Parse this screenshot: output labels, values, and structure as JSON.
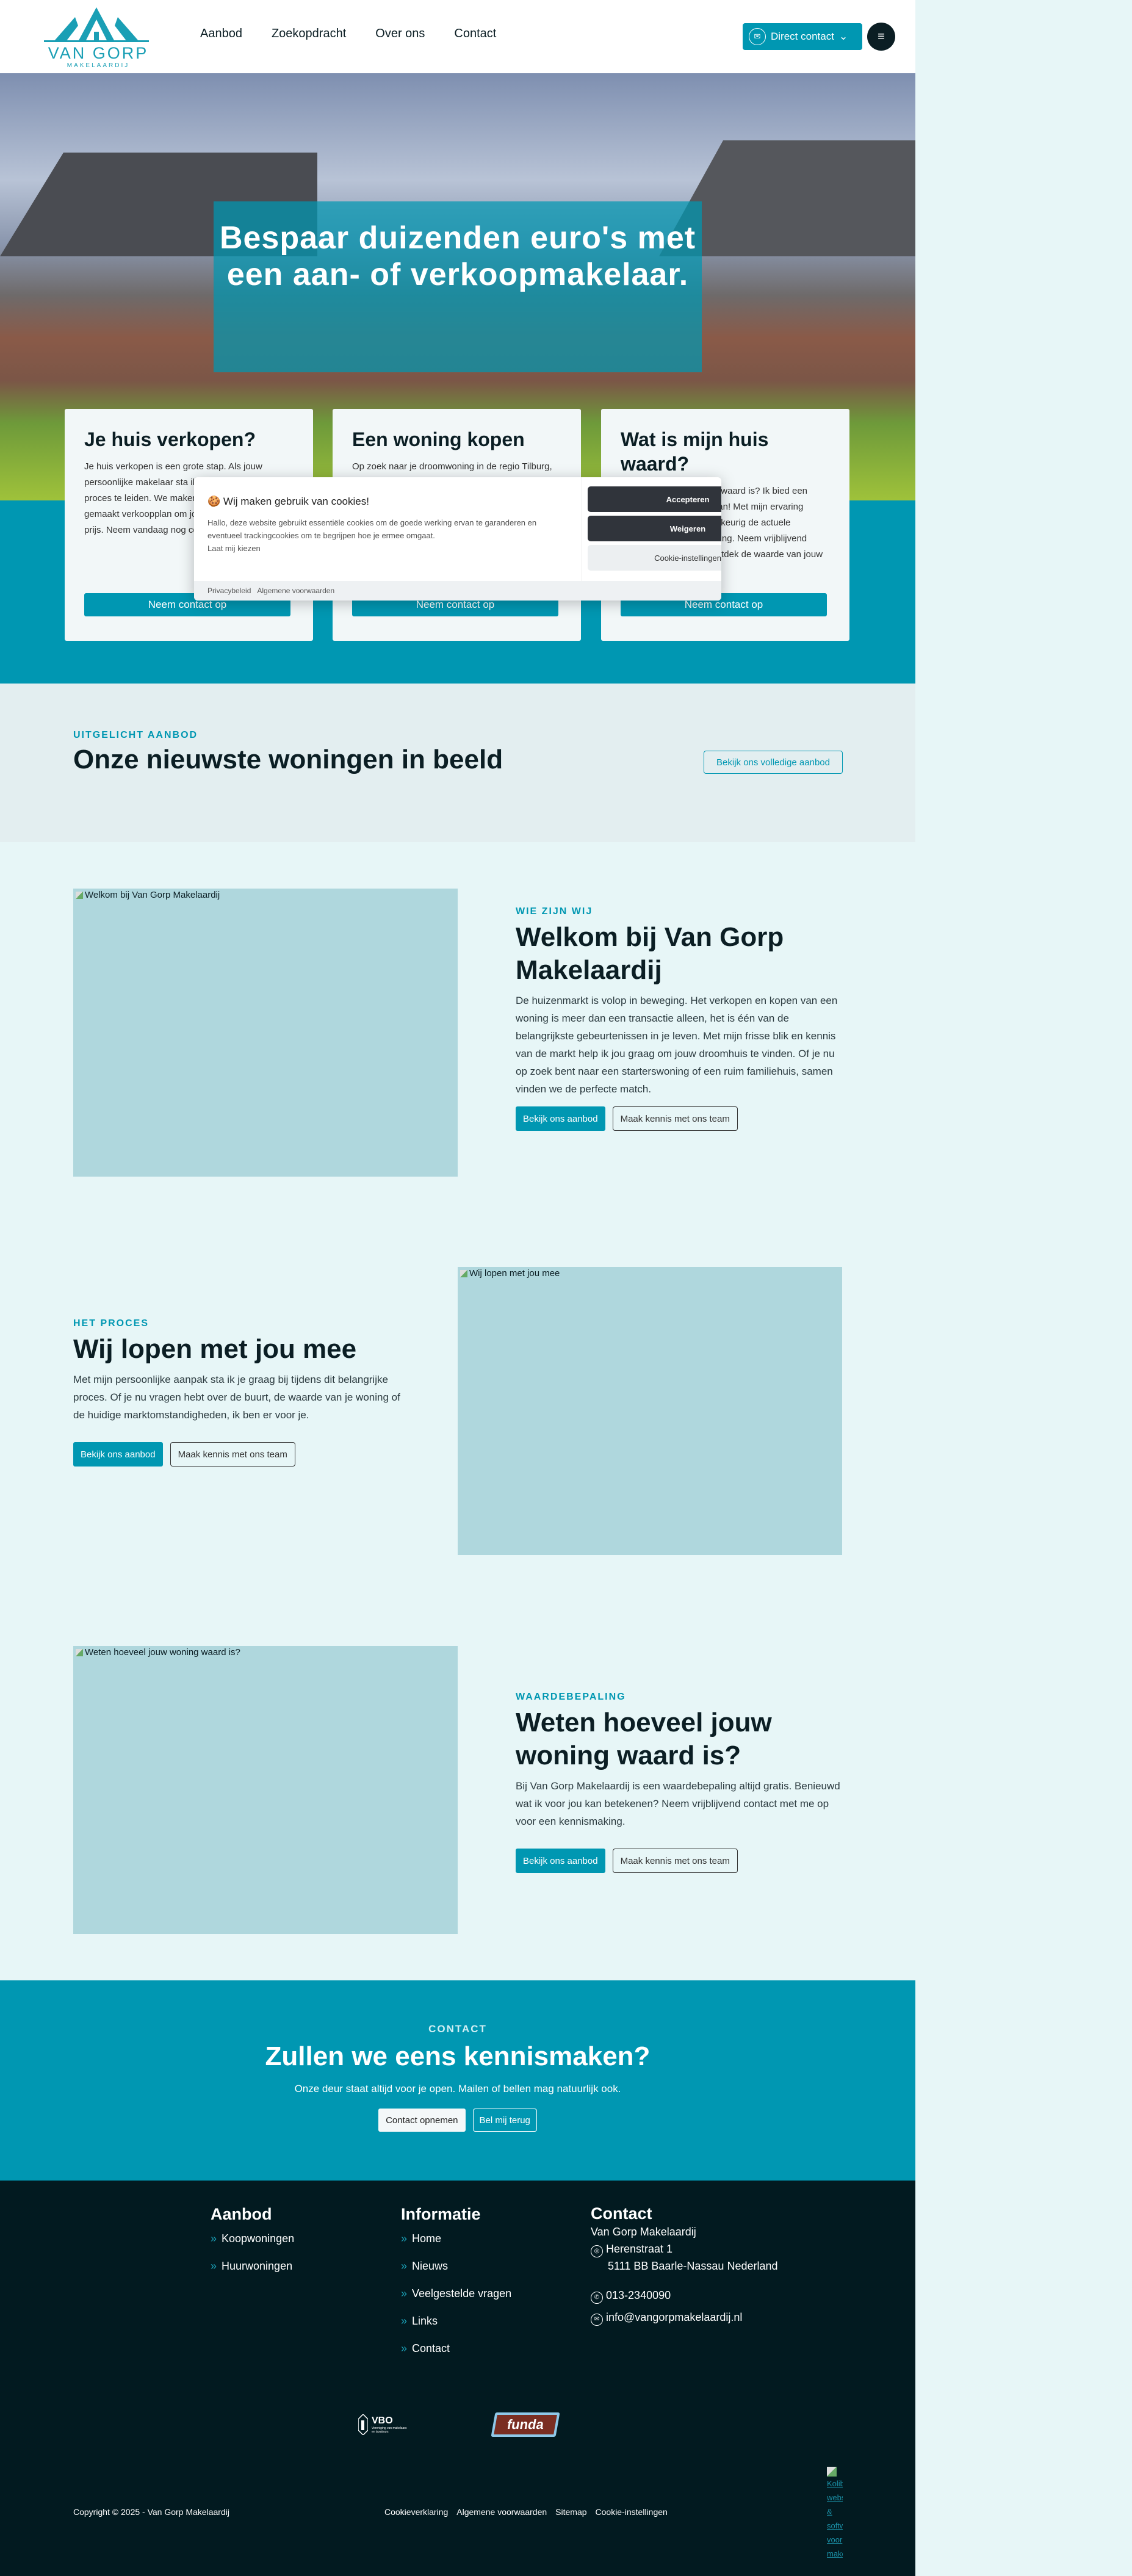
{
  "header": {
    "logo_text": "VAN GORP",
    "logo_sub": "MAKELAARDIJ",
    "nav": [
      "Aanbod",
      "Zoekopdracht",
      "Over ons",
      "Contact"
    ],
    "direct_contact": "Direct contact",
    "menu_icon": "hamburger-icon"
  },
  "hero": {
    "title": "Bespaar duizenden euro's met een aan- of verkoopmakelaar."
  },
  "cards": [
    {
      "title": "Je huis verkopen?",
      "text": "Je huis verkopen is een grote stap. Als jouw persoonlijke makelaar sta ik klaar om jou door dit proces te leiden. We maken samen een op maat gemaakt verkoopplan om jouw huis voor de beste prijs. Neem vandaag nog contact met me op.",
      "button": "Neem contact op"
    },
    {
      "title": "Een woning kopen",
      "text": "Op zoek naar je droomwoning in de regio Tilburg, Baarle-Nassau of Breda?",
      "button": "Neem contact op"
    },
    {
      "title": "Wat is mijn huis waard?",
      "text": "Benieuwd wat jouw huis waard is? Ik bied een gratis waardebepaling aan! Met mijn ervaring bepaal ik eerlijk en nauwkeurig de actuele marktwaarde van je woning. Neem vrijblijvend contact met me op en ontdek de waarde van jouw huis!",
      "button": "Neem contact op"
    }
  ],
  "cookie": {
    "title": "Wij maken gebruik van cookies!",
    "text": "Hallo, deze website gebruikt essentiële cookies om de goede werking ervan te garanderen en eventueel trackingcookies om te begrijpen hoe je ermee omgaat.",
    "choose": "Laat mij kiezen",
    "accept": "Accepteren",
    "reject": "Weigeren",
    "settings": "Cookie-instellingen",
    "links": [
      "Privacybeleid",
      "Algemene voorwaarden"
    ]
  },
  "featured": {
    "eyebrow": "UITGELICHT AANBOD",
    "title": "Onze nieuwste woningen in beeld",
    "button": "Bekijk ons volledige aanbod"
  },
  "sections": [
    {
      "image_alt": "Welkom bij Van Gorp Makelaardij",
      "eyebrow": "WIE ZIJN WIJ",
      "title": "Welkom bij Van Gorp Makelaardij",
      "text": "De huizenmarkt is volop in beweging. Het verkopen en kopen van een woning is meer dan een transactie alleen, het is één van de belangrijkste gebeurtenissen in je leven. Met mijn frisse blik en kennis van de markt help ik jou graag om jouw droomhuis te vinden. Of je nu op zoek bent naar een starterswoning of een ruim familiehuis, samen vinden we de perfecte match.",
      "primary": "Bekijk ons aanbod",
      "secondary": "Maak kennis met ons team"
    },
    {
      "image_alt": "Wij lopen met jou mee",
      "eyebrow": "HET PROCES",
      "title": "Wij lopen met jou mee",
      "text": "Met mijn persoonlijke aanpak sta ik je graag bij tijdens dit belangrijke proces. Of je nu vragen hebt over de buurt, de waarde van je woning of de huidige marktomstandigheden, ik ben er voor je.",
      "primary": "Bekijk ons aanbod",
      "secondary": "Maak kennis met ons team"
    },
    {
      "image_alt": "Weten hoeveel jouw woning waard is?",
      "eyebrow": "WAARDEBEPALING",
      "title": "Weten hoeveel jouw woning waard is?",
      "text": "Bij Van Gorp Makelaardij is een waardebepaling altijd gratis. Benieuwd wat ik voor jou kan betekenen? Neem vrijblijvend contact met me op voor een kennismaking.",
      "primary": "Bekijk ons aanbod",
      "secondary": "Maak kennis met ons team"
    }
  ],
  "contact": {
    "eyebrow": "CONTACT",
    "title": "Zullen we eens kennismaken?",
    "text": "Onze deur staat altijd voor je open. Mailen of bellen mag natuurlijk ook.",
    "primary": "Contact opnemen",
    "secondary": "Bel mij terug"
  },
  "footer": {
    "aanbod": {
      "title": "Aanbod",
      "items": [
        "Koopwoningen",
        "Huurwoningen"
      ]
    },
    "informatie": {
      "title": "Informatie",
      "items": [
        "Home",
        "Nieuws",
        "Veelgestelde vragen",
        "Links",
        "Contact"
      ]
    },
    "contact": {
      "title": "Contact",
      "company": "Van Gorp Makelaardij",
      "street": "Herenstraat 1",
      "city": "5111 BB Baarle-Nassau Nederland",
      "phone": "013-2340090",
      "email": "info@vangorpmakelaardij.nl"
    },
    "logos": {
      "vbo": "VBO",
      "vbo_sub": "Vereniging van makelaars en taxateurs",
      "funda": "funda"
    },
    "copyright": "Copyright © 2025 - Van Gorp Makelaardij",
    "links": [
      "Cookieverklaring",
      "Algemene voorwaarden",
      "Sitemap",
      "Cookie-instellingen"
    ],
    "kolibri": [
      "Kolibri",
      "websites",
      "&",
      "software",
      "voor",
      "makelaars"
    ]
  },
  "colors": {
    "accent": "#0097b2",
    "dark": "#021a20",
    "light": "#e7f6f7"
  }
}
